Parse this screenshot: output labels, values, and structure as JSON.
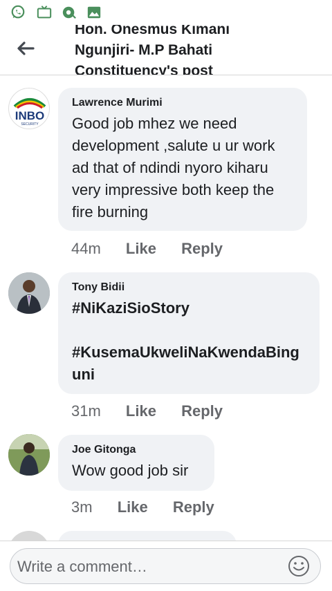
{
  "statusbar": {
    "icons": [
      "whatsapp-icon",
      "tv-icon",
      "vpn-icon",
      "image-icon"
    ]
  },
  "header": {
    "title_lines": [
      "Hon. Onesmus Kimani",
      "Ngunjiri- M.P Bahati",
      "Constituency's post"
    ]
  },
  "comments": [
    {
      "author": "Lawrence Murimi",
      "text": "Good job mhez we need development ,salute u ur work ad that of ndindi nyoro kiharu very impressive both keep the fire burning",
      "time": "44m",
      "like": "Like",
      "reply": "Reply",
      "avatar_text": "INBO",
      "avatar_subtext": "SECURITY"
    },
    {
      "author": "Tony Bidii",
      "text": "#NiKaziSioStory\n\n#KusemaUkweliNaKwendaBing\nuni",
      "time": "31m",
      "like": "Like",
      "reply": "Reply"
    },
    {
      "author": "Joe Gitonga",
      "text": "Wow good job sir",
      "time": "3m",
      "like": "Like",
      "reply": "Reply"
    }
  ],
  "composer": {
    "placeholder": "Write a comment…"
  },
  "colors": {
    "bubble": "#f0f2f5",
    "meta": "#65676b",
    "text": "#1c1e21",
    "whatsapp": "#25d366"
  }
}
